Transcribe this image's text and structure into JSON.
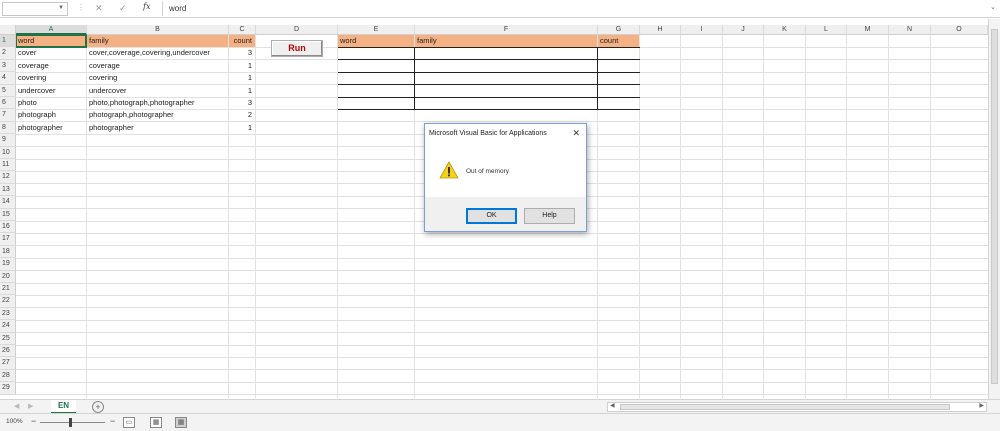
{
  "formula_bar": {
    "name_box": "",
    "formula": "word"
  },
  "columns": [
    "A",
    "B",
    "C",
    "D",
    "E",
    "F",
    "G",
    "H",
    "I",
    "J",
    "K",
    "L",
    "M",
    "N",
    "O"
  ],
  "rows": [
    "1",
    "2",
    "3",
    "4",
    "5",
    "6",
    "7",
    "8",
    "9",
    "10",
    "11",
    "12",
    "13",
    "14",
    "15",
    "16",
    "17",
    "18",
    "19",
    "20",
    "21",
    "22",
    "23",
    "24",
    "25",
    "26",
    "27",
    "28",
    "29"
  ],
  "table1": {
    "headers": [
      "word",
      "family",
      "count"
    ],
    "rows": [
      [
        "cover",
        "cover,coverage,covering,undercover",
        "3"
      ],
      [
        "coverage",
        "coverage",
        "1"
      ],
      [
        "covering",
        "covering",
        "1"
      ],
      [
        "undercover",
        "undercover",
        "1"
      ],
      [
        "photo",
        "photo,photograph,photographer",
        "3"
      ],
      [
        "photograph",
        "photograph,photographer",
        "2"
      ],
      [
        "photographer",
        "photographer",
        "1"
      ]
    ]
  },
  "table2": {
    "headers": [
      "word",
      "family",
      "count"
    ]
  },
  "run_button": {
    "label": "Run"
  },
  "dialog": {
    "title": "Microsoft Visual Basic for Applications",
    "close": "✕",
    "message": "Out of memory",
    "ok_label": "OK",
    "help_label": "Help"
  },
  "sheet_tabs": [
    {
      "label": "EN"
    }
  ],
  "add_sheet": "+",
  "status": {
    "zoom": "100%"
  },
  "colors": {
    "header_fill": "#f4b183",
    "accent": "#217346",
    "run_text": "#c00000"
  }
}
